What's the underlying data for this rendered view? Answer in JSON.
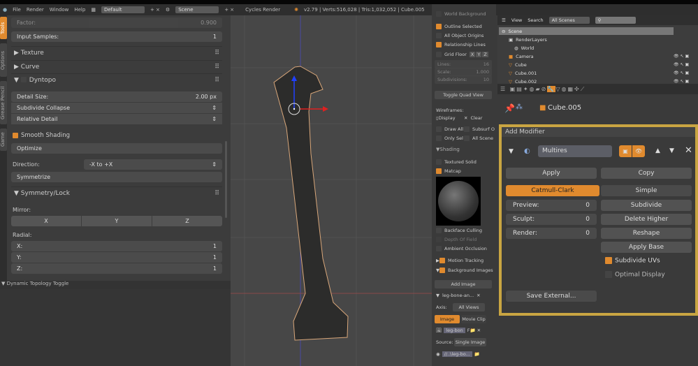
{
  "topbar": {
    "menus": [
      "File",
      "Render",
      "Window",
      "Help"
    ],
    "layout": "Default",
    "scene": "Scene",
    "engine": "Cycles Render",
    "stats": "v2.79 | Verts:516,028 | Tris:1,032,052 | Cube.005"
  },
  "tabs": [
    "Tools",
    "Options",
    "Grease Pencil",
    "Game"
  ],
  "left": {
    "factor_label": "Factor:",
    "factor_value": "0.900",
    "input_samples_label": "Input Samples:",
    "input_samples_value": "1",
    "texture": "Texture",
    "curve": "Curve",
    "dyntopo": "Dyntopo",
    "detail_size_label": "Detail Size:",
    "detail_size_value": "2.00 px",
    "subdivide_collapse": "Subdivide Collapse",
    "relative_detail": "Relative Detail",
    "smooth_shading": "Smooth Shading",
    "optimize": "Optimize",
    "direction_label": "Direction:",
    "direction_value": "-X to +X",
    "symmetrize": "Symmetrize",
    "symmetry_lock": "Symmetry/Lock",
    "mirror_label": "Mirror:",
    "mirror": [
      "X",
      "Y",
      "Z"
    ],
    "radial_label": "Radial:",
    "radial": [
      {
        "axis": "X:",
        "value": "1"
      },
      {
        "axis": "Y:",
        "value": "1"
      },
      {
        "axis": "Z:",
        "value": "1"
      }
    ]
  },
  "status": "Dynamic Topology Toggle",
  "npanel": {
    "world_background": "World Background",
    "outline_selected": "Outline Selected",
    "all_object_origins": "All Object Origins",
    "relationship_lines": "Relationship Lines",
    "grid_floor": "Grid Floor",
    "grid_axes": [
      "X",
      "Y",
      "Z"
    ],
    "lines_label": "Lines:",
    "lines_value": "16",
    "scale_label": "Scale:",
    "scale_value": "1.000",
    "subdivisions_label": "Subdivisions:",
    "subdivisions_value": "10",
    "toggle_quad": "Toggle Quad View",
    "wireframes": "Wireframes:",
    "display": "Display",
    "clear": "Clear",
    "draw_all": "Draw All",
    "subsurf": "Subsurf O",
    "only_sel": "Only Sel",
    "all_scene": "All Scene",
    "shading": "Shading",
    "textured_solid": "Textured Solid",
    "matcap": "Matcap",
    "backface": "Backface Culling",
    "dof": "Depth Of Field",
    "ao": "Ambient Occlusion",
    "motion_tracking": "Motion Tracking",
    "background_images": "Background Images",
    "add_image": "Add Image",
    "bg_name": "leg-bone-an...",
    "axis_label": "Axis:",
    "axis_value": "All Views",
    "image_tab": "Image",
    "movie_tab": "Movie Clip",
    "img_field": "leg-bon",
    "img_f": "F",
    "source_label": "Source:",
    "source_value": "Single Image",
    "path": "//..\\leg-bo..."
  },
  "outliner": {
    "view": "View",
    "search": "Search",
    "scenes": "All Scenes",
    "filter": "",
    "items": [
      "Scene",
      "RenderLayers",
      "World",
      "Camera",
      "Cube",
      "Cube.001",
      "Cube.002"
    ]
  },
  "props": {
    "object": "Cube.005",
    "add_modifier": "Add Modifier",
    "modifier_name": "Multires",
    "apply": "Apply",
    "copy": "Copy",
    "catmull": "Catmull-Clark",
    "simple": "Simple",
    "preview_label": "Preview:",
    "preview_value": "0",
    "sculpt_label": "Sculpt:",
    "sculpt_value": "0",
    "render_label": "Render:",
    "render_value": "0",
    "subdivide": "Subdivide",
    "delete_higher": "Delete Higher",
    "reshape": "Reshape",
    "apply_base": "Apply Base",
    "subdivide_uvs": "Subdivide UVs",
    "optimal_display": "Optimal Display",
    "save_external": "Save External..."
  },
  "colors": {
    "accent": "#e08a2e",
    "modifier_border": "#c9a542"
  }
}
